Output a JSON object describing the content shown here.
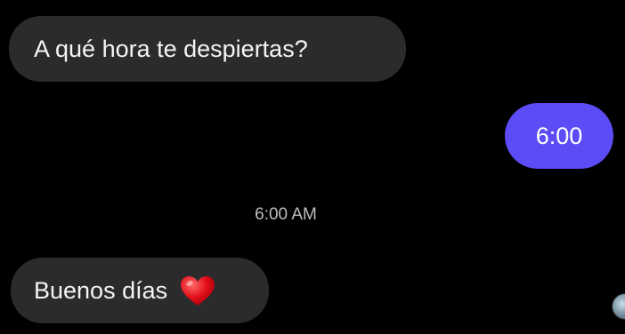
{
  "colors": {
    "background": "#000000",
    "incoming_bubble": "#2b2b2d",
    "outgoing_bubble": "#5b4cf5",
    "timestamp_text": "#bdbdbd"
  },
  "messages": [
    {
      "direction": "incoming",
      "text": "A qué hora te despiertas?"
    },
    {
      "direction": "outgoing",
      "text": "6:00"
    },
    {
      "direction": "incoming",
      "text": "Buenos días",
      "emoji": "red-heart-icon"
    }
  ],
  "timestamp": "6:00 AM",
  "read_receipt_avatar": "avatar-icon"
}
